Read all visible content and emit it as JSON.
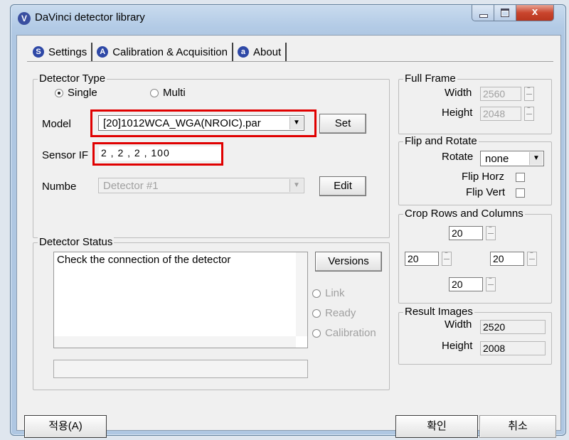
{
  "window": {
    "title": "DaVinci detector library",
    "app_icon": "V",
    "close_glyph": "x"
  },
  "tabs": [
    {
      "label": "Settings",
      "icon": "S"
    },
    {
      "label": "Calibration & Acquisition",
      "icon": "A"
    },
    {
      "label": "About",
      "icon": "a"
    }
  ],
  "detector_type": {
    "label": "Detector Type",
    "single": "Single",
    "multi": "Multi",
    "selected": "Single"
  },
  "model": {
    "label": "Model",
    "value": "[20]1012WCA_WGA(NROIC).par",
    "set_button": "Set"
  },
  "sensor_ip": {
    "label": "Sensor IF",
    "value": "2  ,  2  ,  2  , 100"
  },
  "number": {
    "label": "Numbe",
    "value": "Detector #1",
    "edit_button": "Edit"
  },
  "detector_status": {
    "label": "Detector Status",
    "message": "Check the connection of the detector",
    "versions_button": "Versions",
    "link": "Link",
    "ready": "Ready",
    "calibration": "Calibration"
  },
  "full_frame": {
    "label": "Full Frame",
    "width_label": "Width",
    "width": "2560",
    "height_label": "Height",
    "height": "2048"
  },
  "flip_rotate": {
    "label": "Flip and Rotate",
    "rotate_label": "Rotate",
    "rotate_value": "none",
    "flip_horz": "Flip Horz",
    "flip_vert": "Flip Vert"
  },
  "crop": {
    "label": "Crop Rows and Columns",
    "top": "20",
    "left": "20",
    "right": "20",
    "bottom": "20"
  },
  "result_images": {
    "label": "Result Images",
    "width_label": "Width",
    "width": "2520",
    "height_label": "Height",
    "height": "2008"
  },
  "footer": {
    "apply": "적용(A)",
    "ok": "확인",
    "cancel": "취소"
  }
}
